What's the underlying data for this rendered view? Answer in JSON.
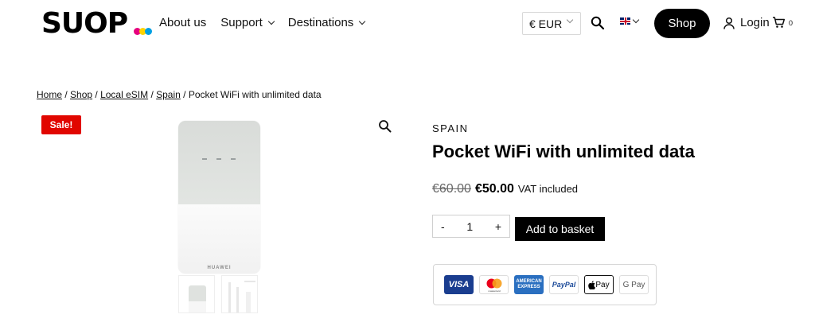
{
  "header": {
    "logo_text": "SUOP",
    "nav": [
      {
        "label": "About us"
      },
      {
        "label": "Support"
      },
      {
        "label": "Destinations"
      }
    ],
    "currency": "€ EUR",
    "shop_label": "Shop",
    "login_label": "Login",
    "cart_count": "0"
  },
  "breadcrumb": {
    "items": [
      "Home",
      "Shop",
      "Local eSIM",
      "Spain"
    ],
    "current": "Pocket WiFi with unlimited data"
  },
  "gallery": {
    "sale_badge": "Sale!",
    "device_brand": "HUAWEI"
  },
  "product": {
    "category": "SPAIN",
    "title": "Pocket WiFi with unlimited data",
    "old_price": "€60.00",
    "new_price": "€50.00",
    "vat_note": "VAT included",
    "quantity": "1",
    "qty_minus": "-",
    "qty_plus": "+",
    "add_to_basket": "Add to basket"
  },
  "payments": {
    "methods": [
      "VISA",
      "Mastercard",
      "American Express",
      "PayPal",
      "Apple Pay",
      "G Pay"
    ],
    "visa": "VISA",
    "amex_top": "AMERICAN",
    "amex_bottom": "EXPRESS",
    "paypal": "PayPal",
    "apple": "Pay",
    "gpay": "G Pay",
    "mc_label": "mastercard"
  },
  "colors": {
    "brand_black": "#000000",
    "sale_red": "#e10600",
    "logo_dots": [
      "#e6007e",
      "#ffd400",
      "#00a0e3"
    ]
  }
}
